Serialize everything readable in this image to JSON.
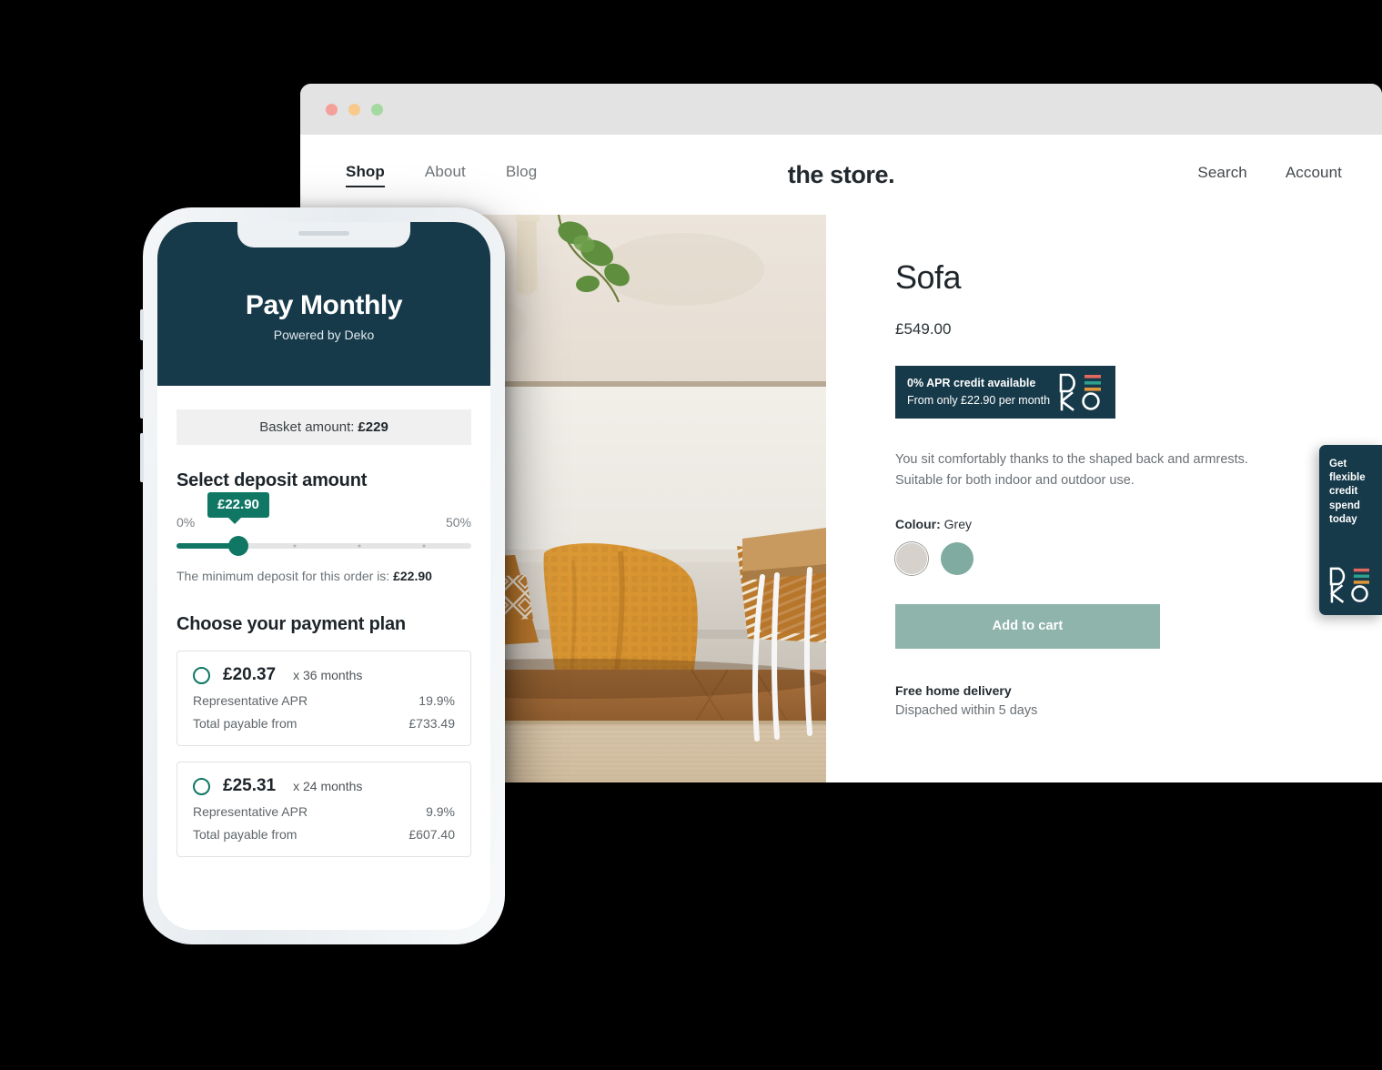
{
  "browser": {
    "traffic_lights": [
      "close",
      "minimize",
      "maximize"
    ],
    "nav": [
      {
        "label": "Shop",
        "active": true
      },
      {
        "label": "About",
        "active": false
      },
      {
        "label": "Blog",
        "active": false
      }
    ],
    "brand": "the store.",
    "actions": [
      {
        "label": "Search"
      },
      {
        "label": "Account"
      }
    ]
  },
  "product": {
    "title": "Sofa",
    "price": "£549.00",
    "banner": {
      "line1": "0% APR credit available",
      "line2": "From only £22.90 per month",
      "logo": "deko-logo"
    },
    "description_line1": "You sit comfortably thanks to the shaped back and armrests.",
    "description_line2": "Suitable for both indoor and outdoor use.",
    "colour_label": "Colour:",
    "colour_value": "Grey",
    "swatches": [
      {
        "name": "grey",
        "hex": "#d6d2cb",
        "selected": true
      },
      {
        "name": "teal",
        "hex": "#80aba0",
        "selected": false
      }
    ],
    "add_to_cart": "Add to cart",
    "delivery_title": "Free home delivery",
    "delivery_sub": "Dispached within 5 days"
  },
  "side_tab": {
    "text": "Get flexible credit spend today",
    "logo": "deko-logo"
  },
  "phone": {
    "app_title": "Pay Monthly",
    "app_subtitle": "Powered by Deko",
    "basket_label": "Basket amount:",
    "basket_amount": "£229",
    "deposit_section_title": "Select deposit amount",
    "slider": {
      "min_label": "0%",
      "max_label": "50%",
      "tooltip_value": "£22.90",
      "value_percent": 21
    },
    "min_deposit_label": "The minimum deposit for this order is:",
    "min_deposit_value": "£22.90",
    "plan_section_title": "Choose your payment plan",
    "plans": [
      {
        "amount": "£20.37",
        "months": "x 36 months",
        "apr_label": "Representative APR",
        "apr_value": "19.9%",
        "total_label": "Total payable from",
        "total_value": "£733.49",
        "selected": false
      },
      {
        "amount": "£25.31",
        "months": "x 24 months",
        "apr_label": "Representative APR",
        "apr_value": "9.9%",
        "total_label": "Total payable from",
        "total_value": "£607.40",
        "selected": false
      }
    ]
  },
  "colors": {
    "navy": "#173a4a",
    "teal_accent": "#107765",
    "button_green": "#8fb4ab",
    "logo_red": "#e4685d",
    "logo_teal": "#2e9e8f",
    "logo_orange": "#e0973c"
  }
}
